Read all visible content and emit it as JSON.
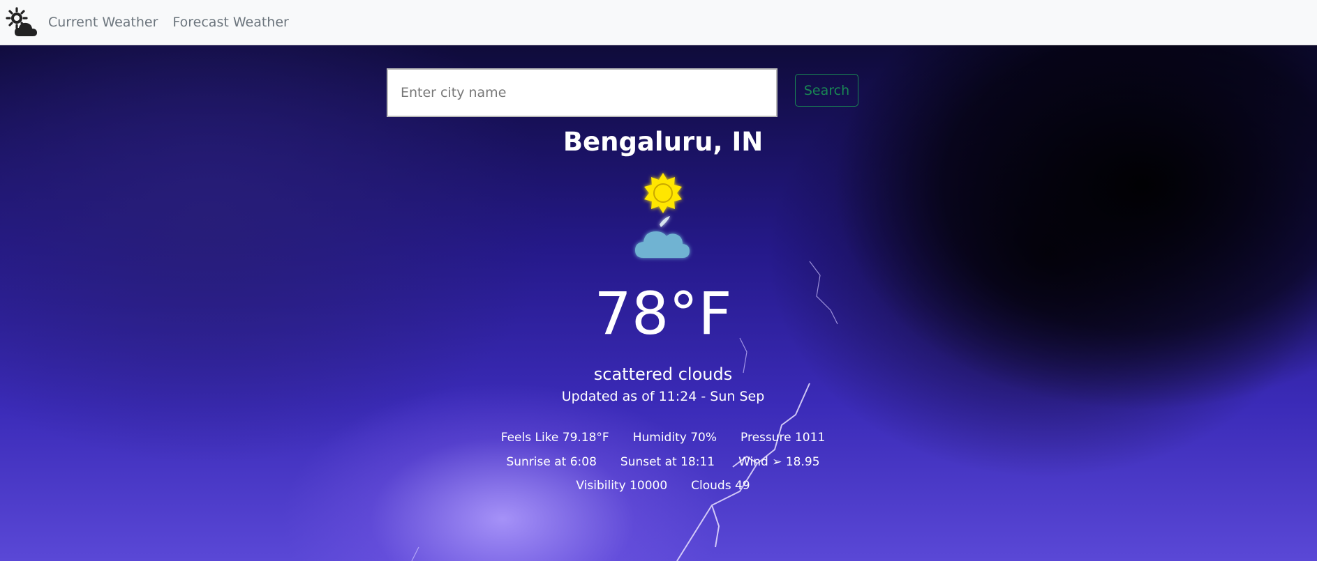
{
  "nav": {
    "brand_icon": "sun-cloud-icon",
    "links": [
      "Current Weather",
      "Forecast Weather"
    ]
  },
  "search": {
    "placeholder": "Enter city name",
    "value": "",
    "button_label": "Search"
  },
  "weather": {
    "city": "Bengaluru, IN",
    "icon": "sun-and-cloud-night-icon",
    "temperature": "78°F",
    "description": "scattered clouds",
    "updated": "Updated as of 11:24 - Sun Sep",
    "details": {
      "feels_like": "Feels Like 79.18°F",
      "humidity": "Humidity 70%",
      "pressure": "Pressure 1011",
      "sunrise": "Sunrise at 6:08",
      "sunset": "Sunset at 18:11",
      "wind": "Wind ➢ 18.95",
      "visibility": "Visibility 10000",
      "clouds": "Clouds 49"
    }
  },
  "colors": {
    "nav_bg": "#f8f9fa",
    "nav_link": "#6c757d",
    "search_accent": "#198754",
    "sun": "#ffe600",
    "cloud": "#6fb3d2"
  }
}
